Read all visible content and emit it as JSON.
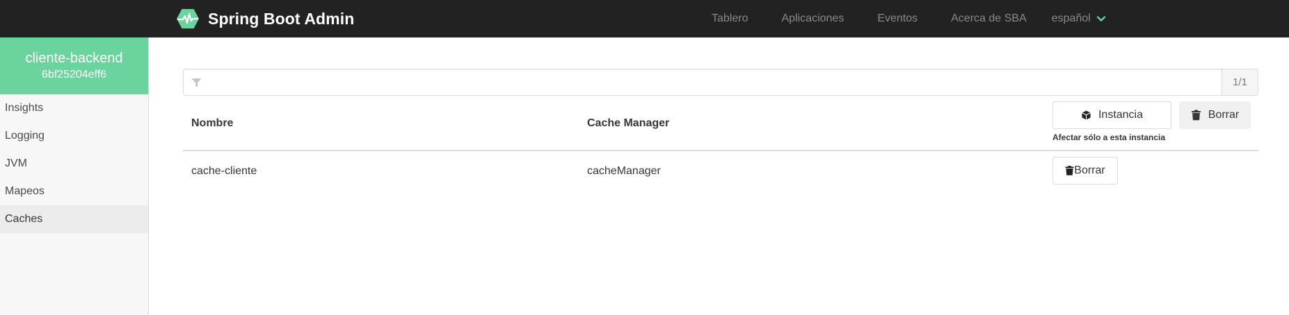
{
  "navbar": {
    "brand": "Spring Boot Admin",
    "links": [
      {
        "label": "Tablero",
        "x": 0
      },
      {
        "label": "Aplicaciones"
      },
      {
        "label": "Eventos"
      },
      {
        "label": "Acerca de SBA"
      }
    ],
    "language": "español",
    "accent_color": "#6bd39e"
  },
  "sidebar": {
    "app_name": "cliente-backend",
    "instance_id": "6bf25204eff6",
    "items": [
      {
        "label": "Insights"
      },
      {
        "label": "Logging"
      },
      {
        "label": "JVM"
      },
      {
        "label": "Mapeos"
      },
      {
        "label": "Caches",
        "active": true
      }
    ]
  },
  "filter": {
    "value": "",
    "placeholder": "",
    "count": "1/1"
  },
  "table": {
    "headers": {
      "name": "Nombre",
      "cache_manager": "Cache Manager"
    },
    "instance_button": "Instancia",
    "clear_all_button": "Borrar",
    "scope_hint": "Afectar sólo a esta instancia",
    "rows": [
      {
        "name": "cache-cliente",
        "cache_manager": "cacheManager",
        "clear_button": "Borrar"
      }
    ]
  }
}
